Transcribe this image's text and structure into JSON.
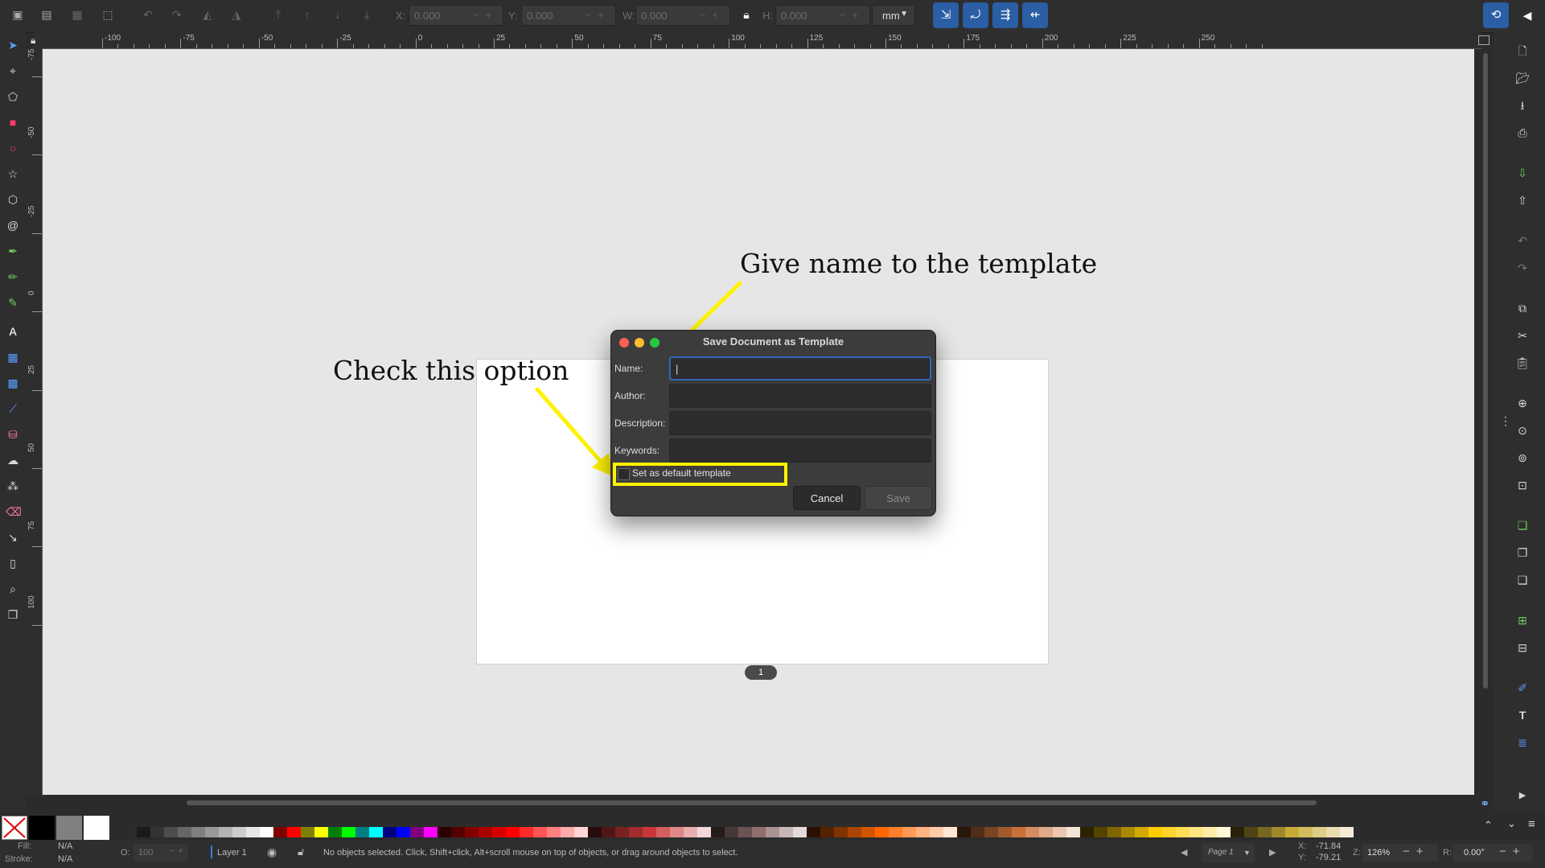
{
  "toolbar": {
    "x_label": "X:",
    "x_value": "0.000",
    "y_label": "Y:",
    "y_value": "0.000",
    "w_label": "W:",
    "w_value": "0.000",
    "h_label": "H:",
    "h_value": "0.000",
    "unit": "mm"
  },
  "rulers": {
    "horizontal": [
      "-100",
      "-75",
      "-50",
      "-25",
      "0",
      "25",
      "50",
      "75",
      "100",
      "125",
      "150",
      "175",
      "200",
      "225",
      "250"
    ],
    "vertical": [
      "-75",
      "-50",
      "-25",
      "0",
      "25",
      "50",
      "75",
      "100"
    ]
  },
  "canvas": {
    "page_number": "1"
  },
  "annotations": {
    "name_hint": "Give name to the template",
    "check_hint": "Check this option",
    "arrow_color": "#fff200"
  },
  "dialog": {
    "title": "Save Document as Template",
    "name_label": "Name:",
    "name_value": "|",
    "author_label": "Author:",
    "description_label": "Description:",
    "keywords_label": "Keywords:",
    "default_checkbox_label": "Set as default template",
    "cancel_label": "Cancel",
    "save_label": "Save"
  },
  "status": {
    "fill_label": "Fill:",
    "fill_value": "N/A",
    "stroke_label": "Stroke:",
    "stroke_value": "N/A",
    "opacity_label": "O:",
    "opacity_value": "100",
    "layer": "Layer 1",
    "message": "No objects selected. Click, Shift+click, Alt+scroll mouse on top of objects, or drag around objects to select.",
    "page_select": "Page 1",
    "x_coord_label": "X:",
    "x_coord": "-71.84",
    "y_coord_label": "Y:",
    "y_coord": "-79.21",
    "zoom_label": "Z:",
    "zoom": "126%",
    "rotation_label": "R:",
    "rotation": "0.00°"
  },
  "palette": {
    "colors": [
      "#1a1a1a",
      "#333333",
      "#4d4d4d",
      "#666666",
      "#808080",
      "#999999",
      "#b3b3b3",
      "#cccccc",
      "#e6e6e6",
      "#ffffff",
      "#800000",
      "#ff0000",
      "#808000",
      "#ffff00",
      "#008000",
      "#00ff00",
      "#008080",
      "#00ffff",
      "#000080",
      "#0000ff",
      "#800080",
      "#ff00ff",
      "#2b0000",
      "#550000",
      "#800000",
      "#aa0000",
      "#d40000",
      "#ff0000",
      "#ff2a2a",
      "#ff5555",
      "#ff8080",
      "#ffaaaa",
      "#ffd5d5",
      "#280b0b",
      "#501616",
      "#782121",
      "#a02c2c",
      "#c83737",
      "#d35f5f",
      "#de8787",
      "#e9afaf",
      "#f4d7d7",
      "#241c1c",
      "#483737",
      "#6c5353",
      "#916f6f",
      "#ac9393",
      "#c8b7b7",
      "#e3dbdb",
      "#2b1100",
      "#552200",
      "#803300",
      "#aa4400",
      "#d45500",
      "#ff6600",
      "#ff7f2a",
      "#ff9955",
      "#ffb380",
      "#ffccaa",
      "#ffe6d5",
      "#28170b",
      "#502d16",
      "#784421",
      "#a05a2c",
      "#c87137",
      "#d38d5f",
      "#deaa87",
      "#e9c6af",
      "#f4e3d7",
      "#2b2200",
      "#554400",
      "#806600",
      "#aa8800",
      "#d4aa00",
      "#ffcc00",
      "#ffd42a",
      "#ffdd55",
      "#ffe680",
      "#ffeeaa",
      "#fff6d5",
      "#28220b",
      "#504416",
      "#786721",
      "#a0892c",
      "#c8ab37",
      "#d3bc5f",
      "#decd87",
      "#e9ddaf",
      "#f4eed7"
    ]
  }
}
